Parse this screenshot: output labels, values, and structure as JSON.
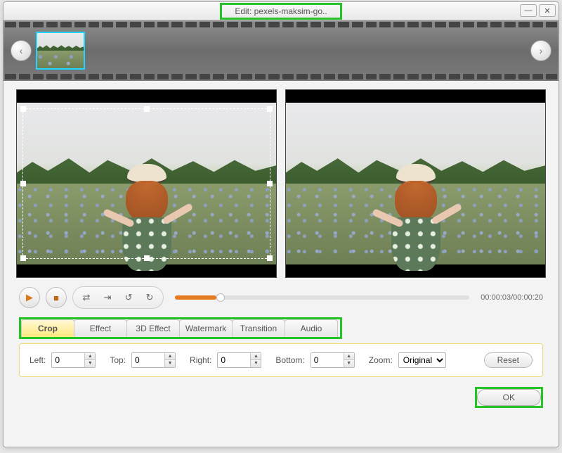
{
  "window": {
    "title": "Edit: pexels-maksim-go.."
  },
  "player": {
    "time_current": "00:00:03",
    "time_total": "00:00:20",
    "time_display": "00:00:03/00:00:20"
  },
  "tabs": [
    {
      "label": "Crop"
    },
    {
      "label": "Effect"
    },
    {
      "label": "3D Effect"
    },
    {
      "label": "Watermark"
    },
    {
      "label": "Transition"
    },
    {
      "label": "Audio"
    }
  ],
  "crop": {
    "left_label": "Left:",
    "top_label": "Top:",
    "right_label": "Right:",
    "bottom_label": "Bottom:",
    "zoom_label": "Zoom:",
    "left": "0",
    "top": "0",
    "right": "0",
    "bottom": "0",
    "zoom": "Original",
    "zoom_options": [
      "Original"
    ]
  },
  "buttons": {
    "reset": "Reset",
    "ok": "OK"
  },
  "icons": {
    "prev": "‹",
    "next": "›",
    "play": "▶",
    "stop": "■",
    "shuffle": "⇄",
    "step": "⇥",
    "undo": "↺",
    "redo": "↻",
    "min": "—",
    "close": "✕",
    "up": "▲",
    "down": "▼"
  }
}
